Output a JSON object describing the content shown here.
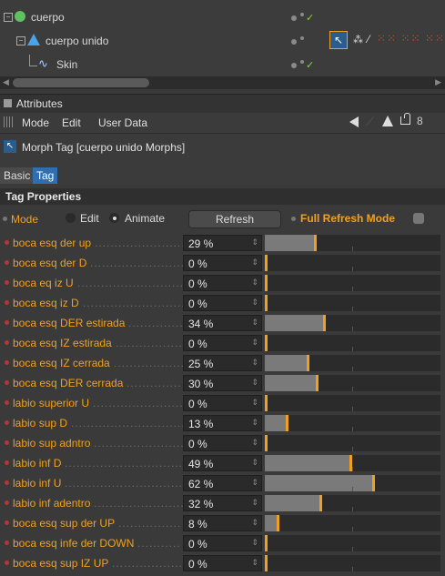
{
  "object_manager": {
    "items": [
      {
        "label": "cuerpo"
      },
      {
        "label": "cuerpo unido"
      },
      {
        "label": "Skin"
      }
    ]
  },
  "attributes": {
    "title": "Attributes",
    "menu": [
      "Mode",
      "Edit",
      "User Data"
    ],
    "tag_title": "Morph Tag [cuerpo unido Morphs]",
    "tabs": [
      "Basic",
      "Tag"
    ],
    "section_title": "Tag Properties",
    "mode_label": "Mode",
    "mode_edit": "Edit",
    "mode_animate": "Animate",
    "refresh_button": "Refresh",
    "full_refresh_label": "Full Refresh Mode"
  },
  "morphs": [
    {
      "label": "boca esq der up",
      "value": "29 %",
      "fraction": 0.29
    },
    {
      "label": "boca esq der D",
      "value": "0 %",
      "fraction": 0
    },
    {
      "label": "boca eq iz U",
      "value": "0 %",
      "fraction": 0
    },
    {
      "label": "boca esq iz D",
      "value": "0 %",
      "fraction": 0
    },
    {
      "label": "boca esq DER estirada",
      "value": "34 %",
      "fraction": 0.34
    },
    {
      "label": "boca esq IZ estirada",
      "value": "0 %",
      "fraction": 0
    },
    {
      "label": "boca esq IZ cerrada",
      "value": "25 %",
      "fraction": 0.25
    },
    {
      "label": "boca esq DER cerrada",
      "value": "30 %",
      "fraction": 0.3
    },
    {
      "label": "labio superior U",
      "value": "0 %",
      "fraction": 0
    },
    {
      "label": "labio sup D",
      "value": "13 %",
      "fraction": 0.13
    },
    {
      "label": "labio sup adntro",
      "value": "0 %",
      "fraction": 0
    },
    {
      "label": "labio inf D",
      "value": "49 %",
      "fraction": 0.49
    },
    {
      "label": "labio inf U",
      "value": "62 %",
      "fraction": 0.62
    },
    {
      "label": "labio inf adentro",
      "value": "32 %",
      "fraction": 0.32
    },
    {
      "label": "boca esq sup der UP",
      "value": "8 %",
      "fraction": 0.08
    },
    {
      "label": "boca esq infe der DOWN",
      "value": "0 %",
      "fraction": 0
    },
    {
      "label": "boca esq sup IZ UP",
      "value": "0 %",
      "fraction": 0
    }
  ],
  "colors": {
    "accent": "#f0a020",
    "label_orange": "#f0a020",
    "check_green": "#8bd04a",
    "selected_tab": "#2f6fb0"
  }
}
